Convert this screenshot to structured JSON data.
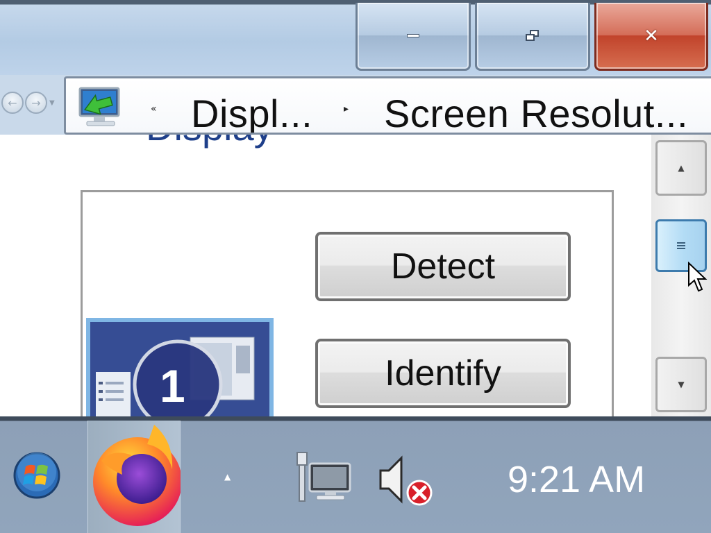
{
  "window": {
    "caption_buttons": {
      "minimize": "minimize-icon",
      "restore": "restore-icon",
      "close": "close-icon"
    }
  },
  "address_bar": {
    "separator_overflow": "«",
    "breadcrumbs": [
      {
        "label": "Displ..."
      },
      {
        "label": "Screen Resolut..."
      }
    ],
    "separator": "▸"
  },
  "content": {
    "heading_partial": "Display",
    "buttons": {
      "detect": "Detect",
      "identify": "Identify"
    },
    "monitor_number": "1"
  },
  "taskbar": {
    "clock": "9:21 AM",
    "tray_overflow": "▲",
    "apps": [
      "Firefox"
    ]
  },
  "colors": {
    "accent": "#3d7bad",
    "close": "#c1432b",
    "taskbar": "#8da0b7"
  }
}
